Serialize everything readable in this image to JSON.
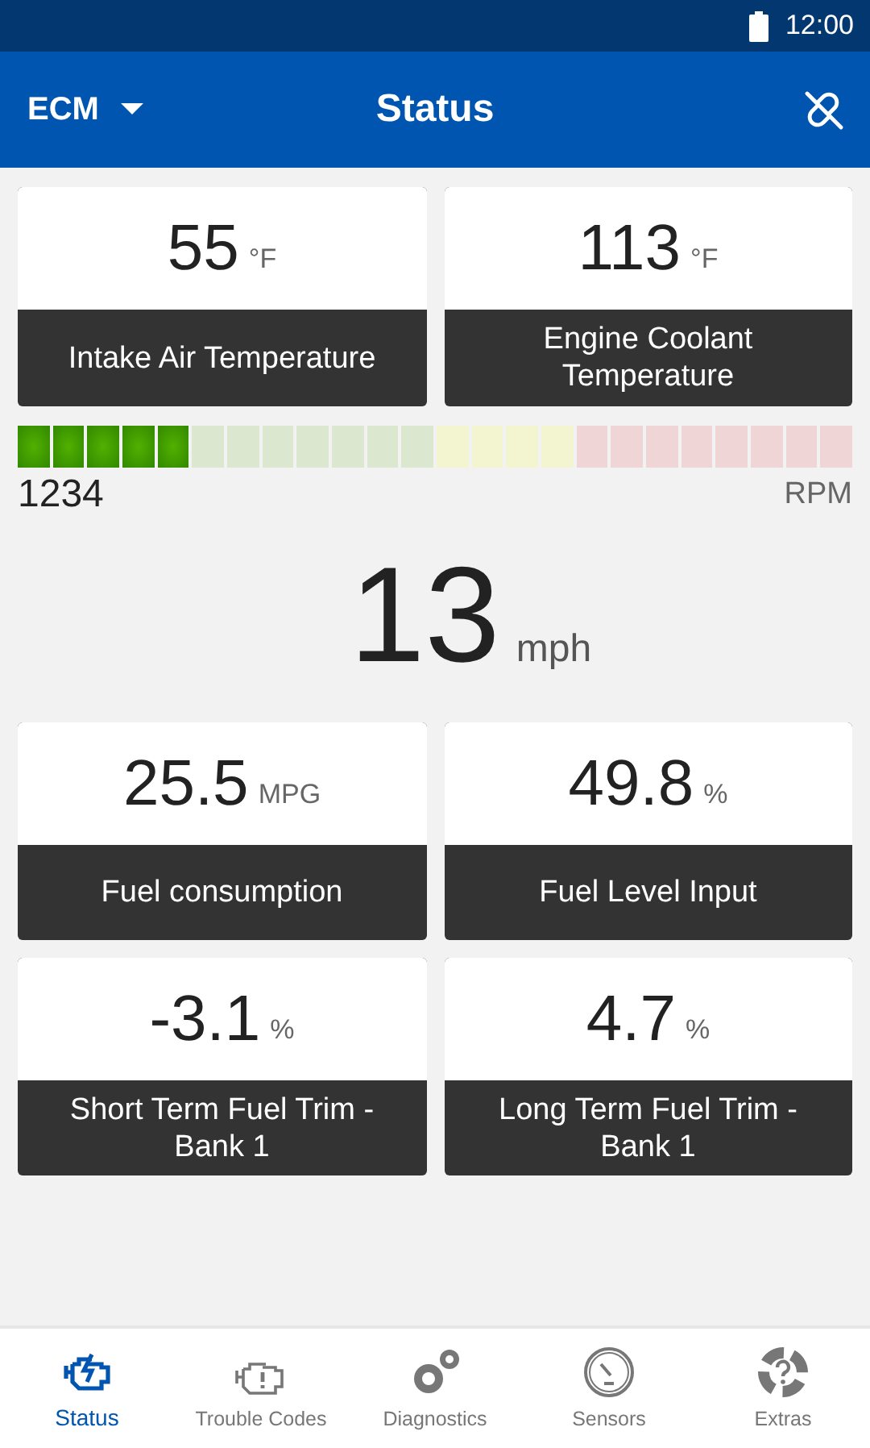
{
  "status_bar": {
    "time": "12:00"
  },
  "app_bar": {
    "module": "ECM",
    "title": "Status"
  },
  "top_cards": [
    {
      "value": "55",
      "unit": "°F",
      "label": "Intake Air Temperature"
    },
    {
      "value": "113",
      "unit": "°F",
      "label": "Engine Coolant Temperature"
    }
  ],
  "rpm": {
    "level": 0.2083,
    "reading": "1234",
    "unit": "RPM"
  },
  "speed": {
    "value": "13",
    "unit": "mph"
  },
  "bottom_cards": [
    {
      "value": "25.5",
      "unit": "MPG",
      "label": "Fuel consumption"
    },
    {
      "value": "49.8",
      "unit": "%",
      "label": "Fuel Level Input"
    },
    {
      "value": "-3.1",
      "unit": "%",
      "label": "Short Term Fuel Trim - Bank 1"
    },
    {
      "value": "4.7",
      "unit": "%",
      "label": "Long Term Fuel Trim - Bank 1"
    }
  ],
  "nav": [
    {
      "label": "Status",
      "kind": "status",
      "selected": true
    },
    {
      "label": "Trouble Codes",
      "kind": "codes",
      "selected": false
    },
    {
      "label": "Diagnostics",
      "kind": "diagnostics",
      "selected": false
    },
    {
      "label": "Sensors",
      "kind": "sensors",
      "selected": false
    },
    {
      "label": "Extras",
      "kind": "extras",
      "selected": false
    }
  ]
}
